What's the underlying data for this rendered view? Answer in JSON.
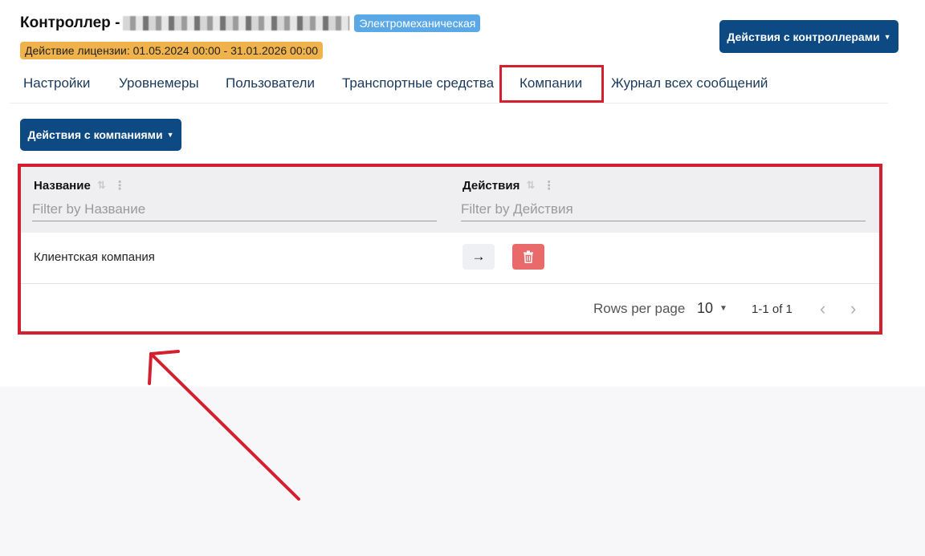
{
  "header": {
    "title": "Контроллер -",
    "type_badge": "Электромеханическая",
    "license": "Действие лицензии: 01.05.2024 00:00 - 31.01.2026 00:00",
    "controller_actions_label": "Действия с контроллерами"
  },
  "tabs": [
    {
      "label": "Настройки"
    },
    {
      "label": "Уровнемеры"
    },
    {
      "label": "Пользователи"
    },
    {
      "label": "Транспортные средства"
    },
    {
      "label": "Компании",
      "active": true
    },
    {
      "label": "Журнал всех сообщений"
    }
  ],
  "companies": {
    "actions_label": "Действия с компаниями",
    "columns": [
      {
        "title": "Название",
        "filter_placeholder": "Filter by Название"
      },
      {
        "title": "Действия",
        "filter_placeholder": "Filter by Действия"
      }
    ],
    "rows": [
      {
        "name": "Клиентская компания"
      }
    ],
    "footer": {
      "rows_per_page_label": "Rows per page",
      "rows_per_page_value": "10",
      "range": "1-1 of 1"
    }
  },
  "icons": {
    "sort": "sort-icon",
    "column_menu": "kebab-icon",
    "go": "arrow-right-icon",
    "delete": "trash-icon",
    "prev": "chevron-left-icon",
    "next": "chevron-right-icon"
  },
  "colors": {
    "primary": "#0d4a83",
    "type_badge": "#5aa9e6",
    "license_badge": "#f0b24a",
    "delete": "#e86a6a",
    "annotation": "#d4202e"
  }
}
